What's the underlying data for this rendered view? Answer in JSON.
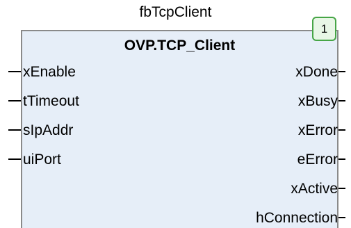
{
  "block": {
    "instance_name": "fbTcpClient",
    "type_name": "OVP.TCP_Client",
    "execution_order": "1"
  },
  "inputs": [
    "xEnable",
    "tTimeout",
    "sIpAddr",
    "uiPort"
  ],
  "outputs": [
    "xDone",
    "xBusy",
    "xError",
    "eError",
    "xActive",
    "hConnection"
  ],
  "colors": {
    "block_fill": "#e6eef8",
    "block_border": "#8a8a8a",
    "badge_border": "#46a546",
    "badge_fill": "#e8f6e6"
  }
}
